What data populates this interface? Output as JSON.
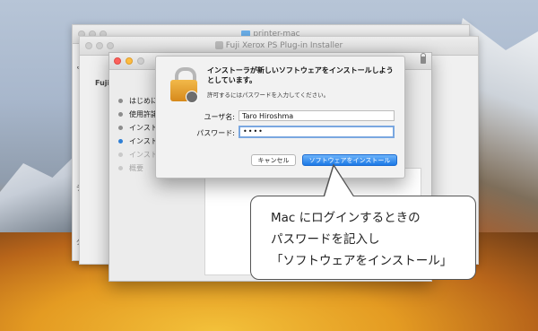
{
  "desktop": {
    "windows": {
      "printer_folder_title": "printer-mac",
      "installer_back_title": "Fuji Xerox PS Plug-in Installer",
      "fragments": [
        "Fuji",
        "よ",
        "デ",
        "ダ"
      ]
    }
  },
  "installer": {
    "steps": [
      {
        "label": "はじめに",
        "state": "done"
      },
      {
        "label": "使用許諾",
        "state": "done"
      },
      {
        "label": "インスト",
        "state": "done"
      },
      {
        "label": "インストール",
        "state": "active"
      },
      {
        "label": "インスト",
        "state": "pending"
      },
      {
        "label": "概要",
        "state": "pending"
      }
    ]
  },
  "auth_dialog": {
    "title": "インストーラが新しいソフトウェアをインストールしようとしています。",
    "subtitle": "許可するにはパスワードを入力してください。",
    "username_label": "ユーザ名:",
    "username_value": "Taro Hiroshma",
    "password_label": "パスワード:",
    "password_value": "••••",
    "cancel_label": "キャンセル",
    "install_label": "ソフトウェアをインストール",
    "accent_color": "#1b79e6"
  },
  "callout": {
    "lines": [
      "Mac にログインするときの",
      "パスワードを記入し",
      "「ソフトウェアをインストール」"
    ]
  }
}
